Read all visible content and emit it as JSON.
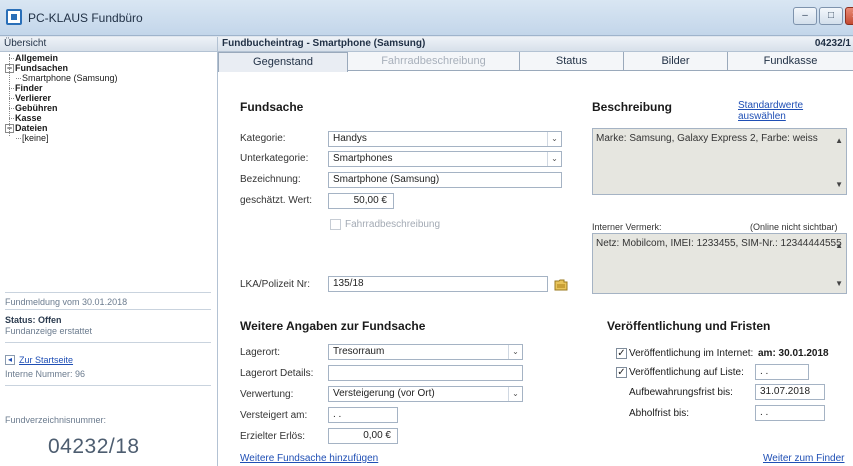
{
  "app": {
    "title": "PC-KLAUS Fundbüro",
    "window_buttons": {
      "minimize": "–",
      "maximize": "□",
      "close": "×"
    }
  },
  "left": {
    "header": "Übersicht",
    "tree": [
      {
        "label": "Allgemein",
        "bold": true,
        "level": 0
      },
      {
        "label": "Fundsachen",
        "bold": true,
        "level": 0,
        "toggle": "−"
      },
      {
        "label": "Smartphone (Samsung)",
        "bold": false,
        "level": 1
      },
      {
        "label": "Finder",
        "bold": true,
        "level": 0
      },
      {
        "label": "Verlierer",
        "bold": true,
        "level": 0
      },
      {
        "label": "Gebühren",
        "bold": true,
        "level": 0
      },
      {
        "label": "Kasse",
        "bold": true,
        "level": 0
      },
      {
        "label": "Dateien",
        "bold": true,
        "level": 0,
        "toggle": "−"
      },
      {
        "label": "[keine]",
        "bold": false,
        "level": 1
      }
    ],
    "fundmeldung": "Fundmeldung vom 30.01.2018",
    "status_title": "Status: Offen",
    "status_sub": "Fundanzeige erstattet",
    "back_link": "Zur Startseite",
    "back_icon": "arrow-left-icon",
    "interne_nummer": "Interne Nummer: 96",
    "fundverzeichnis_label": "Fundverzeichnisnummer:",
    "fundverzeichnis_value": "04232/18"
  },
  "right": {
    "header": "Fundbucheintrag - Smartphone (Samsung)",
    "header_num": "04232/1",
    "tabs": [
      "Gegenstand",
      "Fahrradbeschreibung",
      "Status",
      "Bilder",
      "Fundkasse"
    ],
    "active_tab": "Gegenstand",
    "fundsache": {
      "title": "Fundsache",
      "kategorie_label": "Kategorie:",
      "kategorie_value": "Handys",
      "unterkategorie_label": "Unterkategorie:",
      "unterkategorie_value": "Smartphones",
      "bezeichnung_label": "Bezeichnung:",
      "bezeichnung_value": "Smartphone (Samsung)",
      "wert_label": "geschätzt. Wert:",
      "wert_value": "50,00 €",
      "fahrrad_label": "Fahrradbeschreibung",
      "lka_label": "LKA/Polizeit Nr:",
      "lka_value": "135/18",
      "lka_icon": "folder-icon"
    },
    "beschreibung": {
      "title": "Beschreibung",
      "link": "Standardwerte auswählen",
      "text": "Marke: Samsung, Galaxy Express 2, Farbe: weiss",
      "vermerk_label": "Interner Vermerk:",
      "vermerk_note": "(Online nicht sichtbar)",
      "vermerk_text": "Netz: Mobilcom, IMEI: 1233455, SIM-Nr.: 12344444555"
    },
    "weitere": {
      "title": "Weitere Angaben zur Fundsache",
      "lagerort_label": "Lagerort:",
      "lagerort_value": "Tresorraum",
      "lagerort_details_label": "Lagerort Details:",
      "lagerort_details_value": "",
      "verwertung_label": "Verwertung:",
      "verwertung_value": "Versteigerung (vor Ort)",
      "versteigert_label": "Versteigert am:",
      "versteigert_value": ". .",
      "erloes_label": "Erzielter Erlös:",
      "erloes_value": "0,00 €",
      "add_link": "Weitere Fundsache hinzufügen"
    },
    "veroeffentlichung": {
      "title": "Veröffentlichung und Fristen",
      "internet_label": "Veröffentlichung im Internet:",
      "internet_value": "am: 30.01.2018",
      "liste_label": "Veröffentlichung auf Liste:",
      "liste_value": ". .",
      "aufbewahrung_label": "Aufbewahrungsfrist bis:",
      "aufbewahrung_value": "31.07.2018",
      "abholfrist_label": "Abholfrist bis:",
      "abholfrist_value": ". .",
      "finder_link": "Weiter zum Finder"
    }
  }
}
